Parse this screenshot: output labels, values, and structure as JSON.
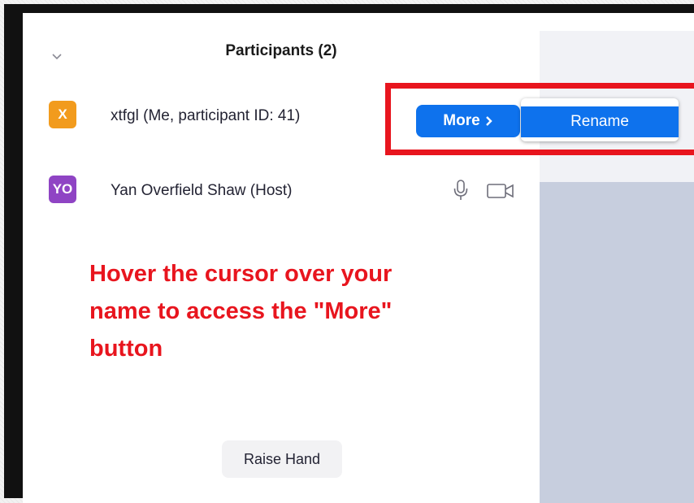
{
  "panel": {
    "title": "Participants (2)",
    "collapse_icon": "chevron-down-icon"
  },
  "participants": [
    {
      "initials": "X",
      "name": "xtfgl (Me, participant ID: 41)",
      "avatar_color": "#f29b1d",
      "hover_button_label": "More",
      "hover_button_icon": "chevron-right-icon"
    },
    {
      "initials": "YO",
      "name": "Yan Overfield Shaw (Host)",
      "avatar_color": "#8f44c4",
      "icons": [
        "microphone-icon",
        "video-camera-icon"
      ]
    }
  ],
  "more_menu": {
    "items": [
      {
        "label": "Rename"
      }
    ]
  },
  "annotation": {
    "text": "Hover the cursor over your name to access the \"More\" button",
    "color": "#e8151e"
  },
  "footer": {
    "raise_hand_label": "Raise Hand"
  },
  "colors": {
    "accent": "#0e72ed",
    "highlight": "#e8151e"
  }
}
